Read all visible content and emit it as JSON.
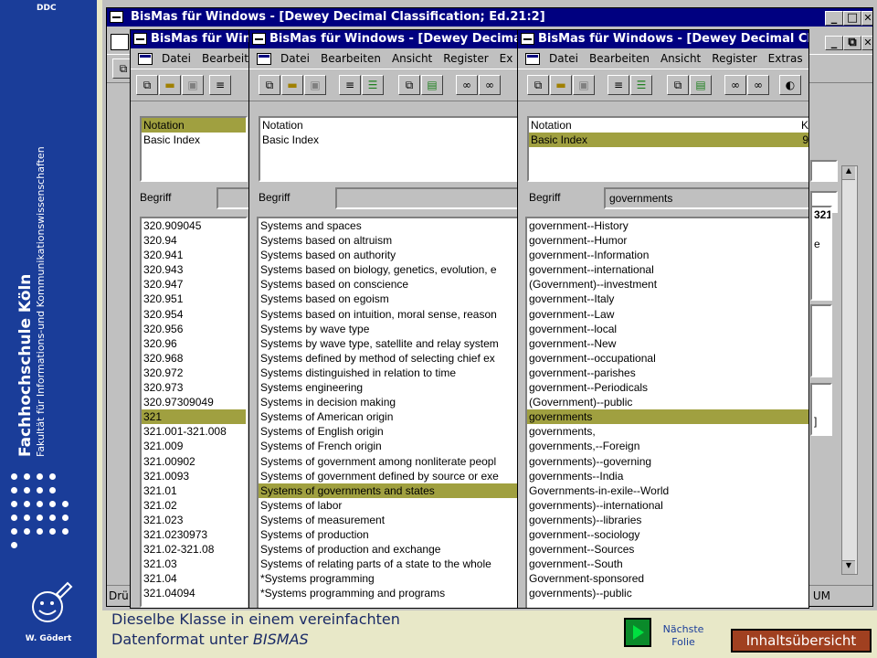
{
  "brand": {
    "corner_tag": "DDC",
    "title": "Fachhochschule Köln",
    "subtitle": "Fakultät für Informations-und Kommunikationswissenschaften",
    "author": "W. Gödert"
  },
  "back_window": {
    "title": "BisMas für Windows - [Dewey Decimal Classification; Ed.21:2]",
    "status_left": "Drü",
    "status_right": "UM",
    "right_panel_texts": [
      "321",
      "e",
      "]"
    ]
  },
  "window1": {
    "title": "BisMas für Windows",
    "menu": [
      "Datei",
      "Bearbeiten"
    ],
    "index_list": [
      {
        "label": "Notation",
        "selected": true
      },
      {
        "label": "Basic Index",
        "selected": false
      }
    ],
    "begriff_label": "Begriff",
    "begriff_value": "",
    "results": [
      {
        "label": "320.909045",
        "selected": false
      },
      {
        "label": "320.94",
        "selected": false
      },
      {
        "label": "320.941",
        "selected": false
      },
      {
        "label": "320.943",
        "selected": false
      },
      {
        "label": "320.947",
        "selected": false
      },
      {
        "label": "320.951",
        "selected": false
      },
      {
        "label": "320.954",
        "selected": false
      },
      {
        "label": "320.956",
        "selected": false
      },
      {
        "label": "320.96",
        "selected": false
      },
      {
        "label": "320.968",
        "selected": false
      },
      {
        "label": "320.972",
        "selected": false
      },
      {
        "label": "320.973",
        "selected": false
      },
      {
        "label": "320.97309049",
        "selected": false
      },
      {
        "label": "321",
        "selected": true
      },
      {
        "label": "321.001-321.008",
        "selected": false
      },
      {
        "label": "321.009",
        "selected": false
      },
      {
        "label": "321.00902",
        "selected": false
      },
      {
        "label": "321.0093",
        "selected": false
      },
      {
        "label": "321.01",
        "selected": false
      },
      {
        "label": "321.02",
        "selected": false
      },
      {
        "label": "321.023",
        "selected": false
      },
      {
        "label": "321.0230973",
        "selected": false
      },
      {
        "label": "321.02-321.08",
        "selected": false
      },
      {
        "label": "321.03",
        "selected": false
      },
      {
        "label": "321.04",
        "selected": false
      },
      {
        "label": "321.04094",
        "selected": false
      }
    ]
  },
  "window2": {
    "title": "BisMas für Windows - [Dewey Decimal",
    "menu": [
      "Datei",
      "Bearbeiten",
      "Ansicht",
      "Register",
      "Ex"
    ],
    "index_list": [
      {
        "label": "Notation",
        "selected": false
      },
      {
        "label": "Basic Index",
        "selected": false
      }
    ],
    "begriff_label": "Begriff",
    "begriff_value": "",
    "results": [
      {
        "label": "Systems and spaces",
        "selected": false
      },
      {
        "label": "Systems based on altruism",
        "selected": false
      },
      {
        "label": "Systems based on authority",
        "selected": false
      },
      {
        "label": "Systems based on biology, genetics, evolution, e",
        "selected": false
      },
      {
        "label": "Systems based on conscience",
        "selected": false
      },
      {
        "label": "Systems based on egoism",
        "selected": false
      },
      {
        "label": "Systems based on intuition, moral sense, reason",
        "selected": false
      },
      {
        "label": "Systems by wave type",
        "selected": false
      },
      {
        "label": "Systems by wave type, satellite and relay system",
        "selected": false
      },
      {
        "label": "Systems defined by method of selecting chief ex",
        "selected": false
      },
      {
        "label": "Systems distinguished in relation to time",
        "selected": false
      },
      {
        "label": "Systems engineering",
        "selected": false
      },
      {
        "label": "Systems in decision making",
        "selected": false
      },
      {
        "label": "Systems of American origin",
        "selected": false
      },
      {
        "label": "Systems of English origin",
        "selected": false
      },
      {
        "label": "Systems of French origin",
        "selected": false
      },
      {
        "label": "Systems of government among nonliterate peopl",
        "selected": false
      },
      {
        "label": "Systems of government defined by source or exe",
        "selected": false
      },
      {
        "label": "Systems of governments and states",
        "selected": true
      },
      {
        "label": "Systems of labor",
        "selected": false
      },
      {
        "label": "Systems of measurement",
        "selected": false
      },
      {
        "label": "Systems of production",
        "selected": false
      },
      {
        "label": "Systems of production and exchange",
        "selected": false
      },
      {
        "label": "Systems of relating parts of a state to the whole",
        "selected": false
      },
      {
        "label": "*Systems programming",
        "selected": false
      },
      {
        "label": "*Systems programming and programs",
        "selected": false
      }
    ]
  },
  "window3": {
    "title": "BisMas für Windows - [Dewey Decimal Cl",
    "menu": [
      "Datei",
      "Bearbeiten",
      "Ansicht",
      "Register",
      "Extras"
    ],
    "index_list": [
      {
        "label": "Notation",
        "selected": false,
        "suffix": "K"
      },
      {
        "label": "Basic Index",
        "selected": true,
        "suffix": "9"
      }
    ],
    "begriff_label": "Begriff",
    "begriff_value": "governments",
    "results": [
      {
        "label": "government--History",
        "selected": false
      },
      {
        "label": "government--Humor",
        "selected": false
      },
      {
        "label": "government--Information",
        "selected": false
      },
      {
        "label": "government--international",
        "selected": false
      },
      {
        "label": "(Government)--investment",
        "selected": false
      },
      {
        "label": "government--Italy",
        "selected": false
      },
      {
        "label": "government--Law",
        "selected": false
      },
      {
        "label": "government--local",
        "selected": false
      },
      {
        "label": "government--New",
        "selected": false
      },
      {
        "label": "government--occupational",
        "selected": false
      },
      {
        "label": "government--parishes",
        "selected": false
      },
      {
        "label": "government--Periodicals",
        "selected": false
      },
      {
        "label": "(Government)--public",
        "selected": false
      },
      {
        "label": "governments",
        "selected": true
      },
      {
        "label": "governments,",
        "selected": false
      },
      {
        "label": "governments,--Foreign",
        "selected": false
      },
      {
        "label": "governments)--governing",
        "selected": false
      },
      {
        "label": "governments--India",
        "selected": false
      },
      {
        "label": "Governments-in-exile--World",
        "selected": false
      },
      {
        "label": "governments)--international",
        "selected": false
      },
      {
        "label": "governments)--libraries",
        "selected": false
      },
      {
        "label": "government--sociology",
        "selected": false
      },
      {
        "label": "government--Sources",
        "selected": false
      },
      {
        "label": "government--South",
        "selected": false
      },
      {
        "label": "Government-sponsored",
        "selected": false
      },
      {
        "label": "governments)--public",
        "selected": false
      }
    ]
  },
  "footer": {
    "caption_line1": "Dieselbe Klasse in einem vereinfachten",
    "caption_line2_prefix": "Datenformat unter ",
    "caption_line2_em": "BISMAS",
    "next_label_1": "Nächste",
    "next_label_2": "Folie",
    "toc_label": "Inhaltsübersicht"
  },
  "colors": {
    "brand_blue": "#1a3d99",
    "title_bar": "#000080",
    "selection": "#a0a040",
    "toc_button": "#a04020",
    "next_button": "#0a8a2a"
  }
}
